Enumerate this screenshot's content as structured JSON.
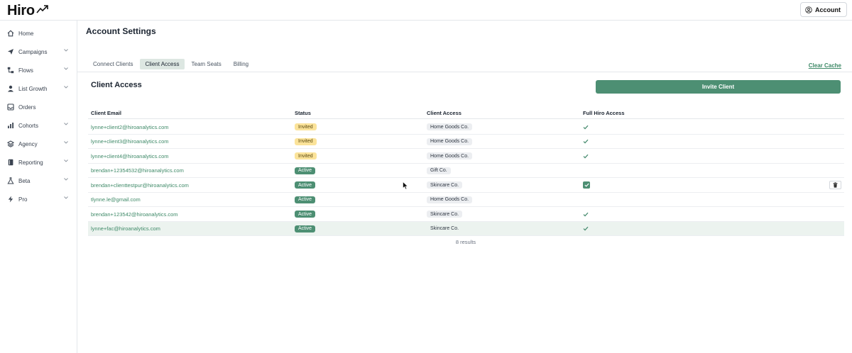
{
  "header": {
    "logo_text": "Hiro",
    "account_label": "Account"
  },
  "sidebar": {
    "items": [
      {
        "label": "Home",
        "icon": "home-icon",
        "has_chevron": false
      },
      {
        "label": "Campaigns",
        "icon": "send-icon",
        "has_chevron": true
      },
      {
        "label": "Flows",
        "icon": "flow-icon",
        "has_chevron": true
      },
      {
        "label": "List Growth",
        "icon": "user-icon",
        "has_chevron": true
      },
      {
        "label": "Orders",
        "icon": "inbox-icon",
        "has_chevron": false
      },
      {
        "label": "Cohorts",
        "icon": "bar-chart-icon",
        "has_chevron": true
      },
      {
        "label": "Agency",
        "icon": "layers-icon",
        "has_chevron": true
      },
      {
        "label": "Reporting",
        "icon": "book-icon",
        "has_chevron": true
      },
      {
        "label": "Beta",
        "icon": "flask-icon",
        "has_chevron": true
      },
      {
        "label": "Pro",
        "icon": "bolt-icon",
        "has_chevron": true
      }
    ]
  },
  "main": {
    "page_title": "Account Settings",
    "tabs": [
      {
        "label": "Connect Clients",
        "active": false
      },
      {
        "label": "Client Access",
        "active": true
      },
      {
        "label": "Team Seats",
        "active": false
      },
      {
        "label": "Billing",
        "active": false
      }
    ],
    "clear_cache_label": "Clear Cache",
    "section_title": "Client Access",
    "invite_button_label": "Invite Client",
    "table": {
      "headers": {
        "email": "Client Email",
        "status": "Status",
        "access": "Client Access",
        "full": "Full Hiro Access"
      },
      "rows": [
        {
          "email": "lynne+client2@hiroanalytics.com",
          "status": "Invited",
          "access": "Home Goods Co.",
          "full": "check"
        },
        {
          "email": "lynne+client3@hiroanalytics.com",
          "status": "Invited",
          "access": "Home Goods Co.",
          "full": "check"
        },
        {
          "email": "lynne+client4@hiroanalytics.com",
          "status": "Invited",
          "access": "Home Goods Co.",
          "full": "check"
        },
        {
          "email": "brendan+12354532@hiroanalytics.com",
          "status": "Active",
          "access": "Gift Co.",
          "full": "none"
        },
        {
          "email": "brendan+clienttestpur@hiroanalytics.com",
          "status": "Active",
          "access": "Skincare Co.",
          "full": "checkbox"
        },
        {
          "email": "tlynne.le@gmail.com",
          "status": "Active",
          "access": "Home Goods Co.",
          "full": "none"
        },
        {
          "email": "brendan+123542@hiroanalytics.com",
          "status": "Active",
          "access": "Skincare Co.",
          "full": "check"
        },
        {
          "email": "lynne+fac@hiroanalytics.com",
          "status": "Active",
          "access": "Skincare Co.",
          "full": "check"
        }
      ],
      "results_text": "8 results"
    }
  },
  "colors": {
    "accent": "#4d8f73",
    "link": "#3f8a68",
    "invited_badge": "#fbe39a",
    "highlight_row": "#ecf3ef"
  }
}
